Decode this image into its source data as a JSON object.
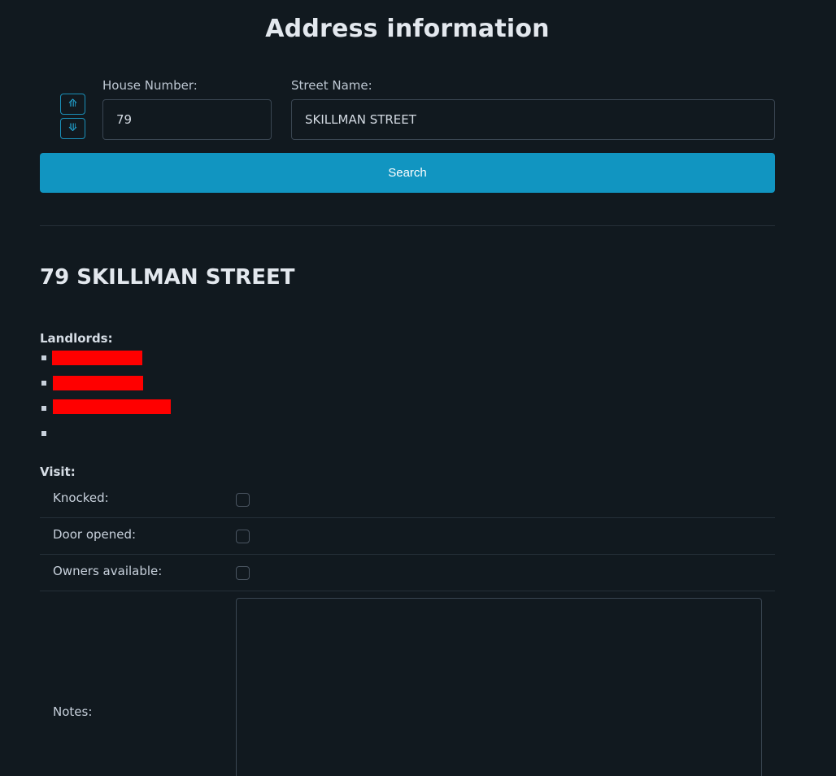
{
  "page": {
    "title": "Address information"
  },
  "search": {
    "up_icon": "⟰",
    "down_icon": "⟱",
    "house_number_label": "House Number:",
    "house_number_value": "79",
    "street_name_label": "Street Name:",
    "street_name_value": "SKILLMAN STREET",
    "search_label": "Search"
  },
  "address": {
    "heading": "79 SKILLMAN STREET",
    "landlords_label": "Landlords:",
    "landlords_redacted": true
  },
  "visit": {
    "label": "Visit:",
    "knocked_label": "Knocked:",
    "knocked_checked": false,
    "door_opened_label": "Door opened:",
    "door_opened_checked": false,
    "owners_available_label": "Owners available:",
    "owners_available_checked": false,
    "notes_label": "Notes:",
    "notes_value": ""
  },
  "colors": {
    "background": "#11191f",
    "accent": "#1195c1",
    "redaction": "#ff0000"
  }
}
